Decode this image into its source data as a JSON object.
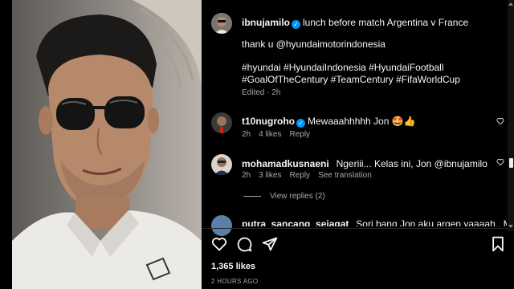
{
  "post": {
    "username": "ibnujamilo",
    "caption_first": "lunch before match Argentina v France",
    "caption_thanks": "thank u @hyundaimotorindonesia",
    "hashtags_line1": "#hyundai #HyundaiIndonesia #HyundaiFootball",
    "hashtags_line2": "#GoalOfTheCentury #TeamCentury #FifaWorldCup",
    "edited": "Edited · 2h"
  },
  "comments": [
    {
      "username": "t10nugroho",
      "verified": true,
      "text": "Mewaaahhhhh Jon 🤩👍",
      "time": "2h",
      "likes": "4 likes",
      "reply": "Reply"
    },
    {
      "username": "mohamadkusnaeni",
      "verified": false,
      "text": "Ngeriii... Kelas ini, Jon @ibnujamilo",
      "time": "2h",
      "likes": "3 likes",
      "reply": "Reply",
      "translate": "See translation"
    },
    {
      "username": "putra_sancang_sejagat",
      "verified": false,
      "text": "Sori bang Jon aku argen yaaaah.. Messi"
    }
  ],
  "view_replies": "View replies (2)",
  "likes_count": "1,365 likes",
  "timestamp": "2 HOURS AGO",
  "icons": [
    "heart-icon",
    "comment-icon",
    "share-icon",
    "bookmark-icon"
  ],
  "colors": {
    "verified": "#0095f6",
    "background": "#000000",
    "secondary_text": "#a8a8a8"
  }
}
